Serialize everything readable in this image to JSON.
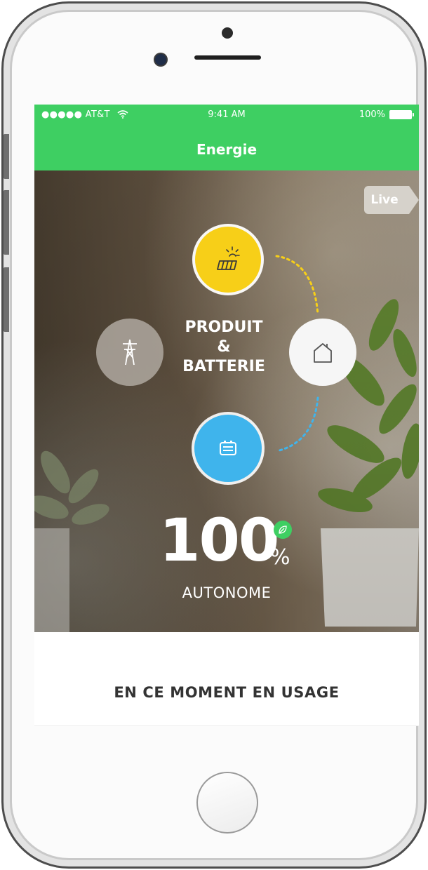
{
  "status_bar": {
    "carrier": "●●●●● AT&T",
    "time": "9:41 AM",
    "battery": "100%"
  },
  "nav": {
    "title": "Energie"
  },
  "hero": {
    "live_label": "Live",
    "center_label_line1": "PRODUIT",
    "center_label_line2": "&",
    "center_label_line3": "BATTERIE",
    "autonomy_value": "100",
    "autonomy_unit": "%",
    "autonomy_label": "AUTONOME",
    "nodes": {
      "solar": {
        "icon": "solar-panel-icon",
        "color": "#f7cf18"
      },
      "grid": {
        "icon": "power-pylon-icon",
        "color": "#afa8a0"
      },
      "home": {
        "icon": "house-icon",
        "color": "#f6f6f6"
      },
      "battery": {
        "icon": "battery-icon",
        "color": "#3fb4ec"
      }
    },
    "flows": {
      "solar_to_home": {
        "color": "#f7cf18"
      },
      "battery_to_home": {
        "color": "#3fb4ec"
      }
    }
  },
  "usage_section": {
    "title": "EN CE MOMENT EN USAGE"
  },
  "tabbar": {
    "items": [
      {
        "icon": "house-outline-icon",
        "active": false
      },
      {
        "icon": "devices-circles-icon",
        "active": false
      },
      {
        "icon": "chart-line-icon",
        "active": true
      },
      {
        "icon": "calendar-icon",
        "active": false,
        "notification_dot": true
      }
    ]
  },
  "colors": {
    "accent_green": "#3ecf62",
    "notification_red": "#e5231b"
  }
}
